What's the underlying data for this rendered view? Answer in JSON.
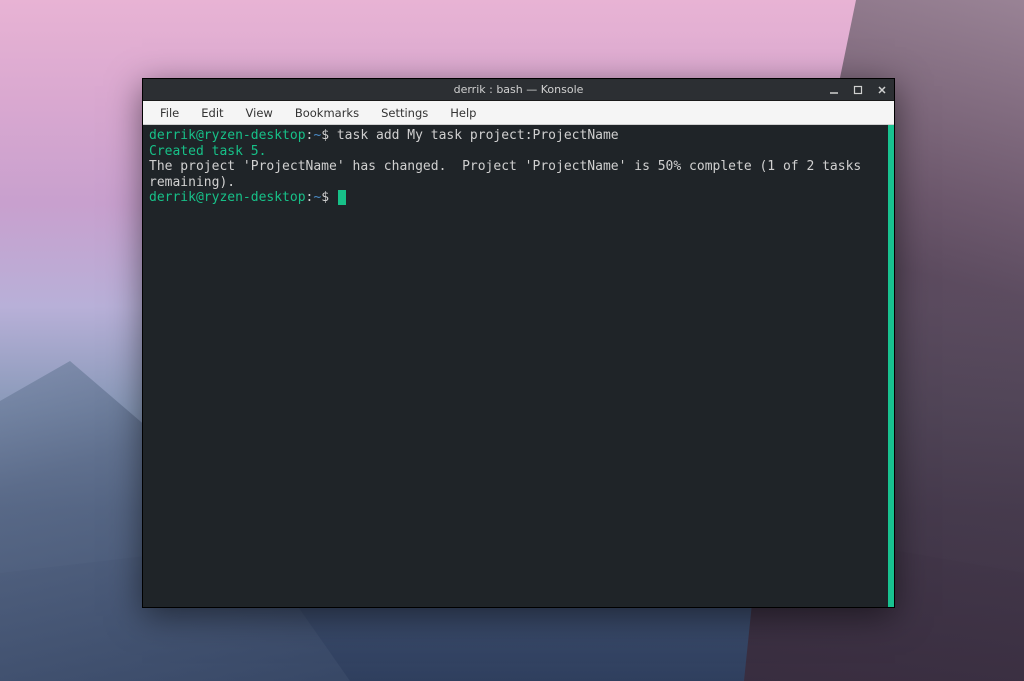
{
  "window": {
    "title": "derrik : bash — Konsole"
  },
  "menubar": {
    "items": [
      "File",
      "Edit",
      "View",
      "Bookmarks",
      "Settings",
      "Help"
    ]
  },
  "terminal": {
    "prompt": {
      "user_host": "derrik@ryzen-desktop",
      "separator": ":",
      "path": "~",
      "symbol": "$"
    },
    "lines": [
      {
        "type": "prompt",
        "command": "task add My task project:ProjectName"
      },
      {
        "type": "output-green",
        "text": "Created task 5."
      },
      {
        "type": "output-white",
        "text": "The project 'ProjectName' has changed.  Project 'ProjectName' is 50% complete (1 of 2 tasks remaining)."
      },
      {
        "type": "prompt-cursor",
        "command": ""
      }
    ]
  },
  "colors": {
    "terminal_bg": "#1f2428",
    "prompt_green": "#17c088",
    "prompt_blue": "#4a8ac5",
    "text_white": "#d0d0d0",
    "scrollbar": "#18c290"
  }
}
